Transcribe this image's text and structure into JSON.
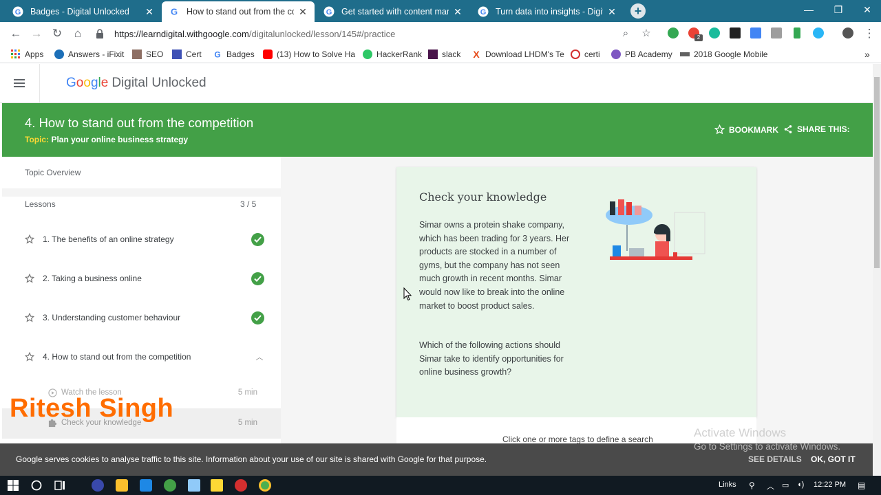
{
  "browser": {
    "tabs": [
      {
        "title": "Badges - Digital Unlocked",
        "active": false
      },
      {
        "title": "How to stand out from the comp",
        "active": true
      },
      {
        "title": "Get started with content marketi",
        "active": false
      },
      {
        "title": "Turn data into insights - Digital U",
        "active": false
      }
    ],
    "url_host": "https://learndigital.withgoogle.com",
    "url_path": "/digitalunlocked/lesson/145#/practice",
    "extension_badge": "2",
    "bookmarks": [
      {
        "label": "Apps",
        "icon": "apps-grid-icon"
      },
      {
        "label": "Answers - iFixit",
        "icon": "ifixit-icon"
      },
      {
        "label": "SEO",
        "icon": "seo-icon"
      },
      {
        "label": "Cert",
        "icon": "chart-icon"
      },
      {
        "label": "Badges",
        "icon": "google-icon"
      },
      {
        "label": "(13) How to Solve Ha",
        "icon": "youtube-icon"
      },
      {
        "label": "HackerRank",
        "icon": "hackerrank-icon"
      },
      {
        "label": "slack",
        "icon": "slack-icon"
      },
      {
        "label": "Download LHDM's Te",
        "icon": "x-icon"
      },
      {
        "label": "certi",
        "icon": "s-icon"
      },
      {
        "label": "PB Academy",
        "icon": "pb-icon"
      },
      {
        "label": "2018 Google Mobile",
        "icon": "bar-icon"
      }
    ],
    "bookmarks_overflow": "»"
  },
  "site": {
    "logo_google": [
      "G",
      "o",
      "o",
      "g",
      "l",
      "e"
    ],
    "logo_product": "Digital Unlocked"
  },
  "banner": {
    "title": "4. How to stand out from the competition",
    "topic_label": "Topic:",
    "topic_value": "Plan your online business strategy",
    "bookmark_label": "BOOKMARK",
    "share_label": "SHARE THIS:"
  },
  "sidebar": {
    "overview": "Topic Overview",
    "lessons_label": "Lessons",
    "lessons_count": "3 / 5",
    "lessons": [
      {
        "label": "1. The benefits of an online strategy",
        "done": true
      },
      {
        "label": "2. Taking a business online",
        "done": true
      },
      {
        "label": "3. Understanding customer behaviour",
        "done": true
      },
      {
        "label": "4. How to stand out from the competition",
        "done": false,
        "expanded": true
      }
    ],
    "sublessons": [
      {
        "label": "Watch the lesson",
        "duration": "5 min"
      },
      {
        "label": "Check your knowledge",
        "duration": "5 min"
      }
    ]
  },
  "watermark": "Ritesh Singh",
  "card": {
    "title": "Check your knowledge",
    "paragraph1": "Simar owns a protein shake company, which has been trading for 3 years. Her products are stocked in a number of gyms, but the company has not seen much growth in recent months. Simar would now like to break into the online market to boost product sales.",
    "paragraph2": "Which of the following actions should Simar take to identify opportunities for online business growth?",
    "hint": "Click one or more tags to define a search"
  },
  "cookie": {
    "message": "Google serves cookies to analyse traffic to this site. Information about your use of our site is shared with Google for that purpose.",
    "see_details": "SEE DETAILS",
    "ok": "OK, GOT IT"
  },
  "windows_watermark": {
    "line1": "Activate Windows",
    "line2": "Go to Settings to activate Windows."
  },
  "taskbar": {
    "links_label": "Links",
    "time": "12:22 PM"
  },
  "colors": {
    "tab_strip": "#1f6d8b",
    "banner_green": "#43a047",
    "topic_yellow": "#fdd835",
    "card_bg": "#e8f5e9",
    "watermark_orange": "#ff6d00"
  }
}
